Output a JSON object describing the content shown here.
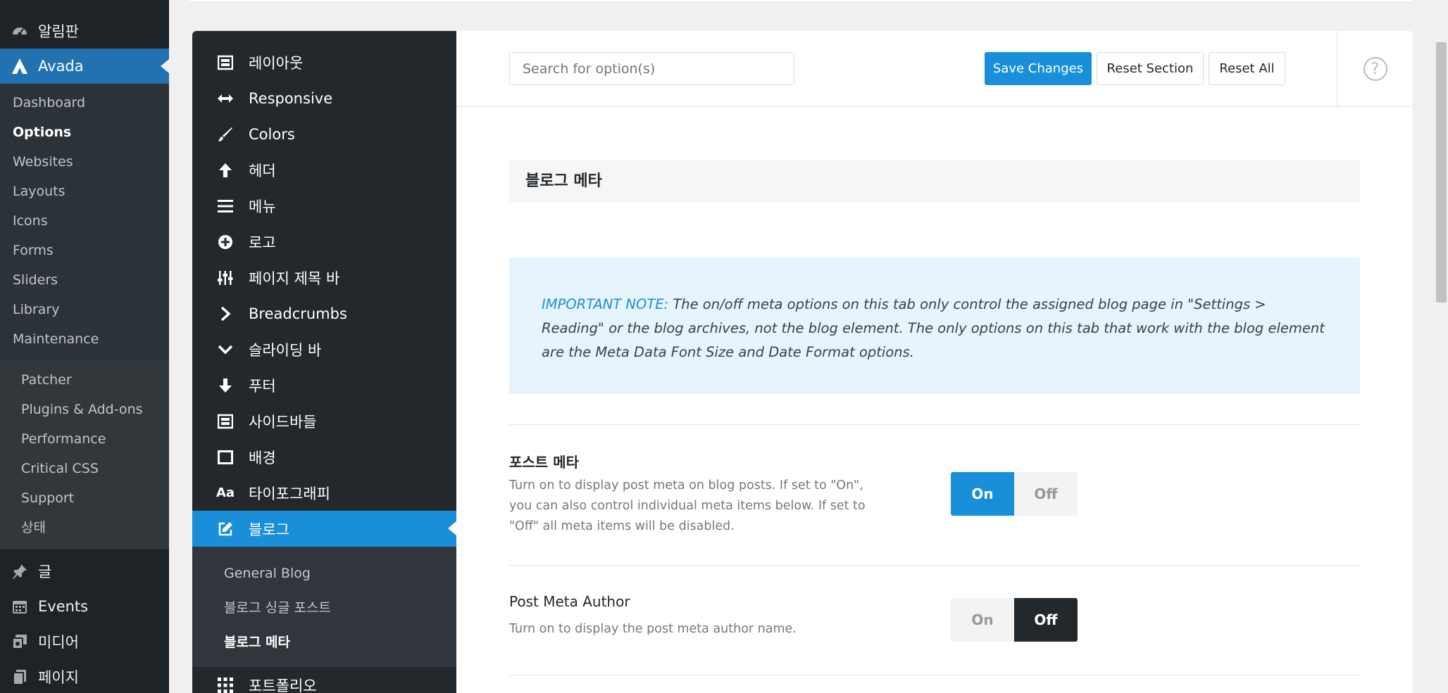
{
  "wp_sidebar": {
    "top_items": [
      {
        "label": "알림판",
        "icon": "dashboard-gauge-icon"
      },
      {
        "label": "Avada",
        "icon": "avada-logo-icon"
      }
    ],
    "avada_sub": [
      "Dashboard",
      "Options",
      "Websites",
      "Layouts",
      "Icons",
      "Forms",
      "Sliders",
      "Library",
      "Maintenance"
    ],
    "avada_sub_current": "Options",
    "maintenance_sub": [
      "Patcher",
      "Plugins & Add-ons",
      "Performance",
      "Critical CSS",
      "Support",
      "상태"
    ],
    "bottom_items": [
      {
        "label": "글",
        "icon": "pushpin-icon"
      },
      {
        "label": "Events",
        "icon": "calendar-icon"
      },
      {
        "label": "미디어",
        "icon": "media-icon"
      },
      {
        "label": "페이지",
        "icon": "pages-icon"
      }
    ]
  },
  "panel_nav": {
    "items": [
      {
        "label": "레이아웃",
        "icon": "layout-icon"
      },
      {
        "label": "Responsive",
        "icon": "arrows-horizontal-icon"
      },
      {
        "label": "Colors",
        "icon": "paintbrush-icon"
      },
      {
        "label": "헤더",
        "icon": "arrow-up-icon"
      },
      {
        "label": "메뉴",
        "icon": "menu-lines-icon"
      },
      {
        "label": "로고",
        "icon": "plus-circle-icon"
      },
      {
        "label": "페이지 제목 바",
        "icon": "sliders-icon"
      },
      {
        "label": "Breadcrumbs",
        "icon": "chevron-right-icon"
      },
      {
        "label": "슬라이딩 바",
        "icon": "chevron-down-icon"
      },
      {
        "label": "푸터",
        "icon": "arrow-down-icon"
      },
      {
        "label": "사이드바들",
        "icon": "sidebar-icon"
      },
      {
        "label": "배경",
        "icon": "background-square-icon"
      },
      {
        "label": "타이포그래피",
        "icon": "typography-icon"
      },
      {
        "label": "블로그",
        "icon": "edit-icon"
      }
    ],
    "blog_sub": [
      "General Blog",
      "블로그 싱글 포스트",
      "블로그 메타"
    ],
    "blog_sub_current": "블로그 메타",
    "after_items": [
      {
        "label": "포트폴리오",
        "icon": "grid-icon"
      }
    ]
  },
  "header": {
    "search_placeholder": "Search for option(s)",
    "save_label": "Save Changes",
    "reset_section_label": "Reset Section",
    "reset_all_label": "Reset All",
    "help_icon": "help-circle-icon"
  },
  "content": {
    "section_title": "블로그 메타",
    "note_label": "IMPORTANT NOTE:",
    "note_text": " The on/off meta options on this tab only control the assigned blog page in \"Settings > Reading\" or the blog archives, not the blog element. The only options on this tab that work with the blog element are the Meta Data Font Size and Date Format options.",
    "options": [
      {
        "title": "포스트 메타",
        "desc": "Turn on to display post meta on blog posts. If set to \"On\", you can also control individual meta items below. If set to \"Off\" all meta items will be disabled.",
        "on_label": "On",
        "off_label": "Off",
        "value": "On"
      },
      {
        "title": "Post Meta Author",
        "desc": "Turn on to display the post meta author name.",
        "on_label": "On",
        "off_label": "Off",
        "value": "Off"
      }
    ]
  },
  "colors": {
    "accent": "#198fd9",
    "wp_active": "#2271b1",
    "dark": "#23282d",
    "note_bg": "#e7f3fd"
  }
}
